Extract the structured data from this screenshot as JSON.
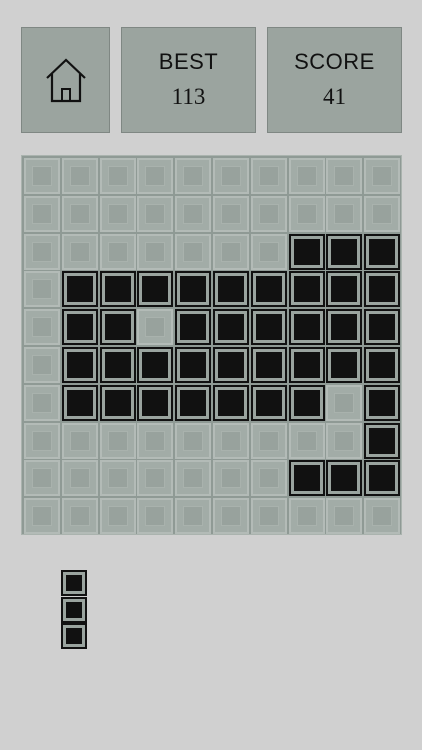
{
  "header": {
    "home_icon": "home-icon",
    "best_label": "BEST",
    "best_value": "113",
    "score_label": "SCORE",
    "score_value": "41"
  },
  "board": {
    "rows": 10,
    "cols": 10,
    "grid": [
      "..........",
      "..........",
      ".......###",
      ".#########",
      ".##.######",
      ".#########",
      ".#######.#",
      ".........#",
      ".......###",
      ".........."
    ]
  },
  "next_piece": {
    "orientation": "vertical",
    "cells": 3
  },
  "colors": {
    "background": "#d0d0d0",
    "panel": "#9ba49f",
    "board": "#8f9a95",
    "filled_block": "#111111"
  }
}
